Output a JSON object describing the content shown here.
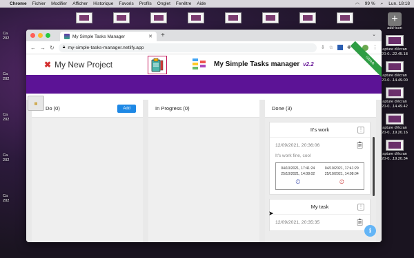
{
  "menubar": {
    "app": "Chrome",
    "items": [
      "Fichier",
      "Modifier",
      "Afficher",
      "Historique",
      "Favoris",
      "Profils",
      "Onglet",
      "Fenêtre",
      "Aide"
    ],
    "battery": "99 %",
    "clock": "Lun. 18:18"
  },
  "desktop": {
    "add_label": "add-icon",
    "right_files": [
      "apture d'écran\n20-0...22.45.18",
      "apture d'écran\n20-0...14.49.00",
      "apture d'écran\n20-0...14.49.42",
      "apture d'écran\n20-0...19.20.16",
      "apture d'écran\n20-0...19.20.34"
    ],
    "left_labels": [
      "Ca\n202",
      "Ca\n202",
      "Ca\n202",
      "Ca\n202",
      "Ca\n202"
    ]
  },
  "browser": {
    "tab_title": "My Simple Tasks Manager",
    "url": "my-simple-tasks-manager.netlify.app"
  },
  "app": {
    "project_name": "My New Project",
    "title": "My Simple Tasks manager",
    "version": "v2.2",
    "ribbon": "GitHub"
  },
  "columns": {
    "todo": {
      "title": "To Do (0)",
      "add_label": "Add"
    },
    "inprogress": {
      "title": "In Progress (0)"
    },
    "done": {
      "title": "Done (3)"
    }
  },
  "cards": [
    {
      "title": "It's work",
      "date": "12/09/2021, 20:36:06",
      "description": "It's work fine, cool",
      "times": {
        "c1a": "04/10/2021, 17:41:24",
        "c1b": "25/10/2021, 14:08:02",
        "c2a": "04/10/2021, 17:41:29",
        "c2b": "25/10/2021, 14:08:04"
      }
    },
    {
      "title": "My task",
      "date": "12/09/2021, 20:35:35"
    }
  ],
  "colors": {
    "purple_bar": "#5c1396",
    "add_button": "#1e88e5"
  }
}
